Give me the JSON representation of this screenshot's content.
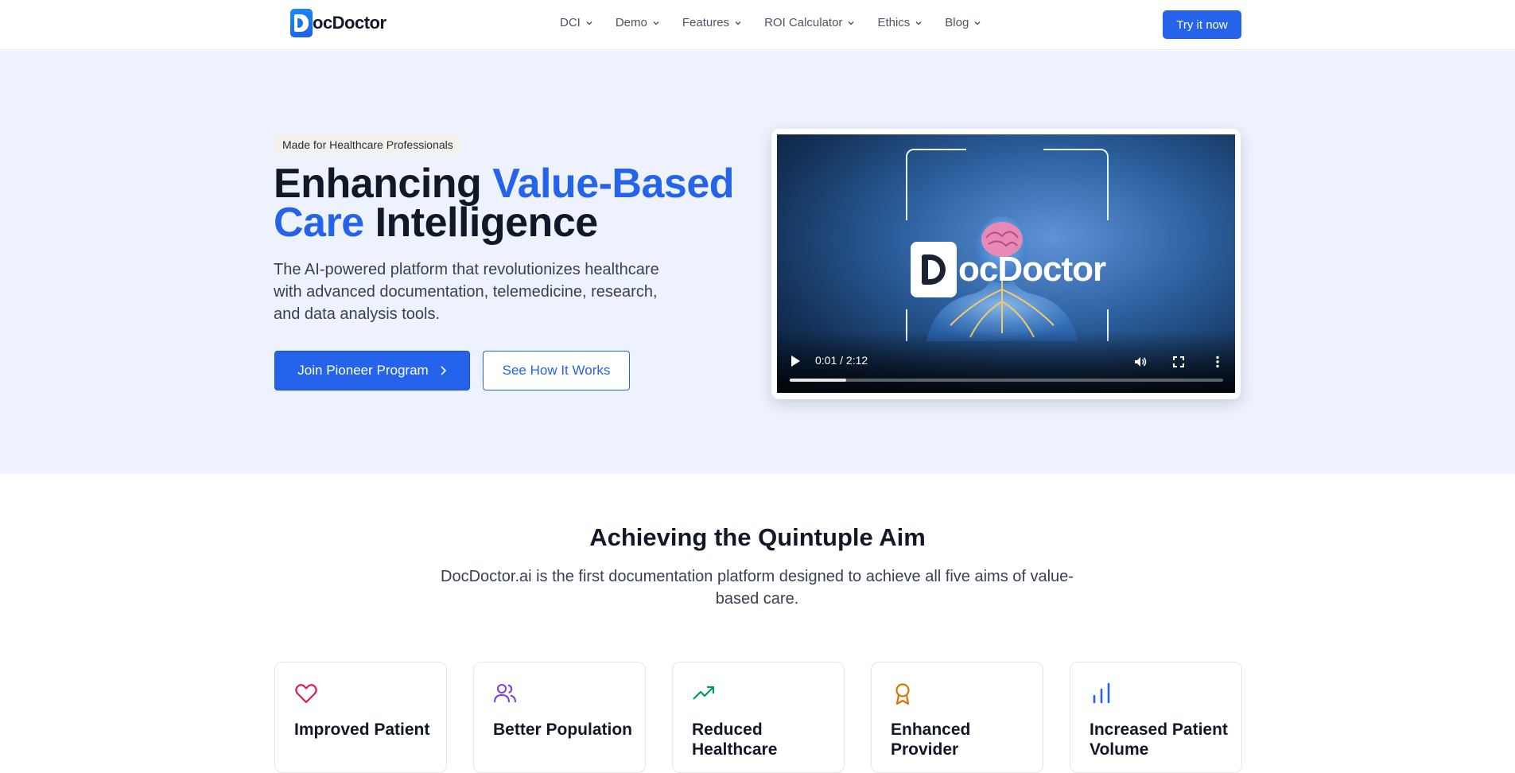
{
  "header": {
    "logo_text": "ocDoctor",
    "nav": [
      {
        "label": "DCI"
      },
      {
        "label": "Demo"
      },
      {
        "label": "Features"
      },
      {
        "label": "ROI Calculator"
      },
      {
        "label": "Ethics"
      },
      {
        "label": "Blog"
      }
    ],
    "cta_label": "Try it now"
  },
  "hero": {
    "badge": "Made for Healthcare Professionals",
    "headline_part1": "Enhancing ",
    "headline_blue1": "Value-Based",
    "headline_blue2": "Care",
    "headline_part2": " Intelligence",
    "subtext": "The AI-powered platform that revolutionizes healthcare with advanced documentation, telemedicine, research, and data analysis tools.",
    "primary_button": "Join Pioneer Program",
    "secondary_button": "See How It Works"
  },
  "video": {
    "logo_text": "ocDoctor",
    "time": "0:01 / 2:12",
    "progress_fraction": 0.13
  },
  "section": {
    "title": "Achieving the Quintuple Aim",
    "subtitle": "DocDoctor.ai is the first documentation platform designed to achieve all five aims of value-based care."
  },
  "cards": [
    {
      "title": "Improved Patient",
      "icon": "heart-icon",
      "color": "#e11d48"
    },
    {
      "title": "Better Population",
      "icon": "users-icon",
      "color": "#7c3aed"
    },
    {
      "title": "Reduced Healthcare",
      "icon": "trending-up-icon",
      "color": "#059669"
    },
    {
      "title": "Enhanced Provider",
      "icon": "award-icon",
      "color": "#d97706"
    },
    {
      "title": "Increased Patient Volume",
      "icon": "bar-chart-icon",
      "color": "#2563eb"
    }
  ],
  "colors": {
    "accent": "#2563eb",
    "hero_bg": "#eef2fc"
  }
}
